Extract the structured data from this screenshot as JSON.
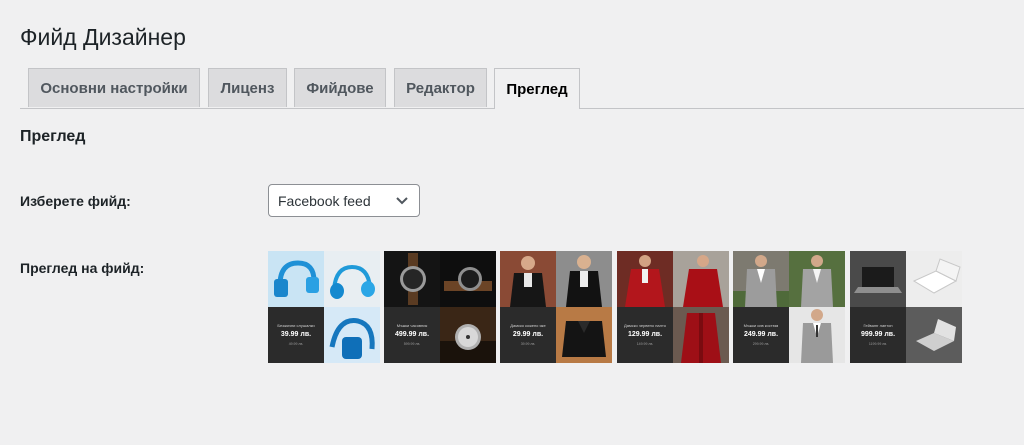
{
  "page": {
    "title": "Фийд Дизайнер"
  },
  "tabs": [
    {
      "label": "Основни настройки"
    },
    {
      "label": "Лиценз"
    },
    {
      "label": "Фийдове"
    },
    {
      "label": "Редактор"
    },
    {
      "label": "Преглед",
      "active": true
    }
  ],
  "section": {
    "title": "Преглед"
  },
  "feed_select": {
    "label": "Изберете фийд:",
    "value": "Facebook feed",
    "icon": "chevron-down-icon"
  },
  "preview": {
    "label": "Преглед на фийд:",
    "products": [
      {
        "name": "Безжични слушалки",
        "price": "39.99 лв.",
        "old_price": "49.99 лв.",
        "theme": "headphones"
      },
      {
        "name": "Мъжки часовник",
        "price": "499.99 лв.",
        "old_price": "599.99 лв.",
        "theme": "watch"
      },
      {
        "name": "Дамско кожено яке",
        "price": "29.99 лв.",
        "old_price": "39.99 лв.",
        "theme": "jacket"
      },
      {
        "name": "Дамско червено палто",
        "price": "129.99 лв.",
        "old_price": "149.99 лв.",
        "theme": "coat"
      },
      {
        "name": "Мъжки сив костюм",
        "price": "249.99 лв.",
        "old_price": "299.99 лв.",
        "theme": "suit"
      },
      {
        "name": "Гейминг лаптоп",
        "price": "999.99 лв.",
        "old_price": "1199.99 лв.",
        "theme": "laptop"
      }
    ]
  }
}
